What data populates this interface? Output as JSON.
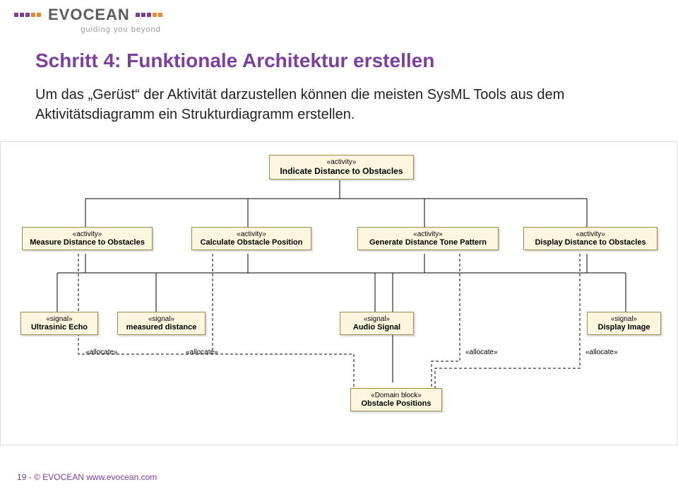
{
  "logo": {
    "word": "EVOCEAN",
    "tagline": "guiding you beyond"
  },
  "page": {
    "title": "Schritt 4: Funktionale Architektur erstellen",
    "body": "Um das „Gerüst“ der Aktivität darzustellen können die meisten SysML Tools aus dem Aktivitätsdiagramm ein Strukturdiagramm erstellen."
  },
  "diagram": {
    "root": {
      "stereotype": "«activity»",
      "name": "Indicate Distance to Obstacles"
    },
    "act1": {
      "stereotype": "«activity»",
      "name": "Measure Distance to Obstacles"
    },
    "act2": {
      "stereotype": "«activity»",
      "name": "Calculate Obstacle Position"
    },
    "act3": {
      "stereotype": "«activity»",
      "name": "Generate Distance Tone Pattern"
    },
    "act4": {
      "stereotype": "«activity»",
      "name": "Display Distance to Obstacles"
    },
    "sig1": {
      "stereotype": "«signal»",
      "name": "Ultrasinic Echo"
    },
    "sig2": {
      "stereotype": "«signal»",
      "name": "measured distance"
    },
    "sig3": {
      "stereotype": "«signal»",
      "name": "Audio Signal"
    },
    "sig4": {
      "stereotype": "«signal»",
      "name": "Display Image"
    },
    "domain": {
      "stereotype": "«Domain block»",
      "name": "Obstacle Positions"
    },
    "alloc": "«allocate»"
  },
  "footer": "19 - © EVOCEAN www.evocean.com"
}
